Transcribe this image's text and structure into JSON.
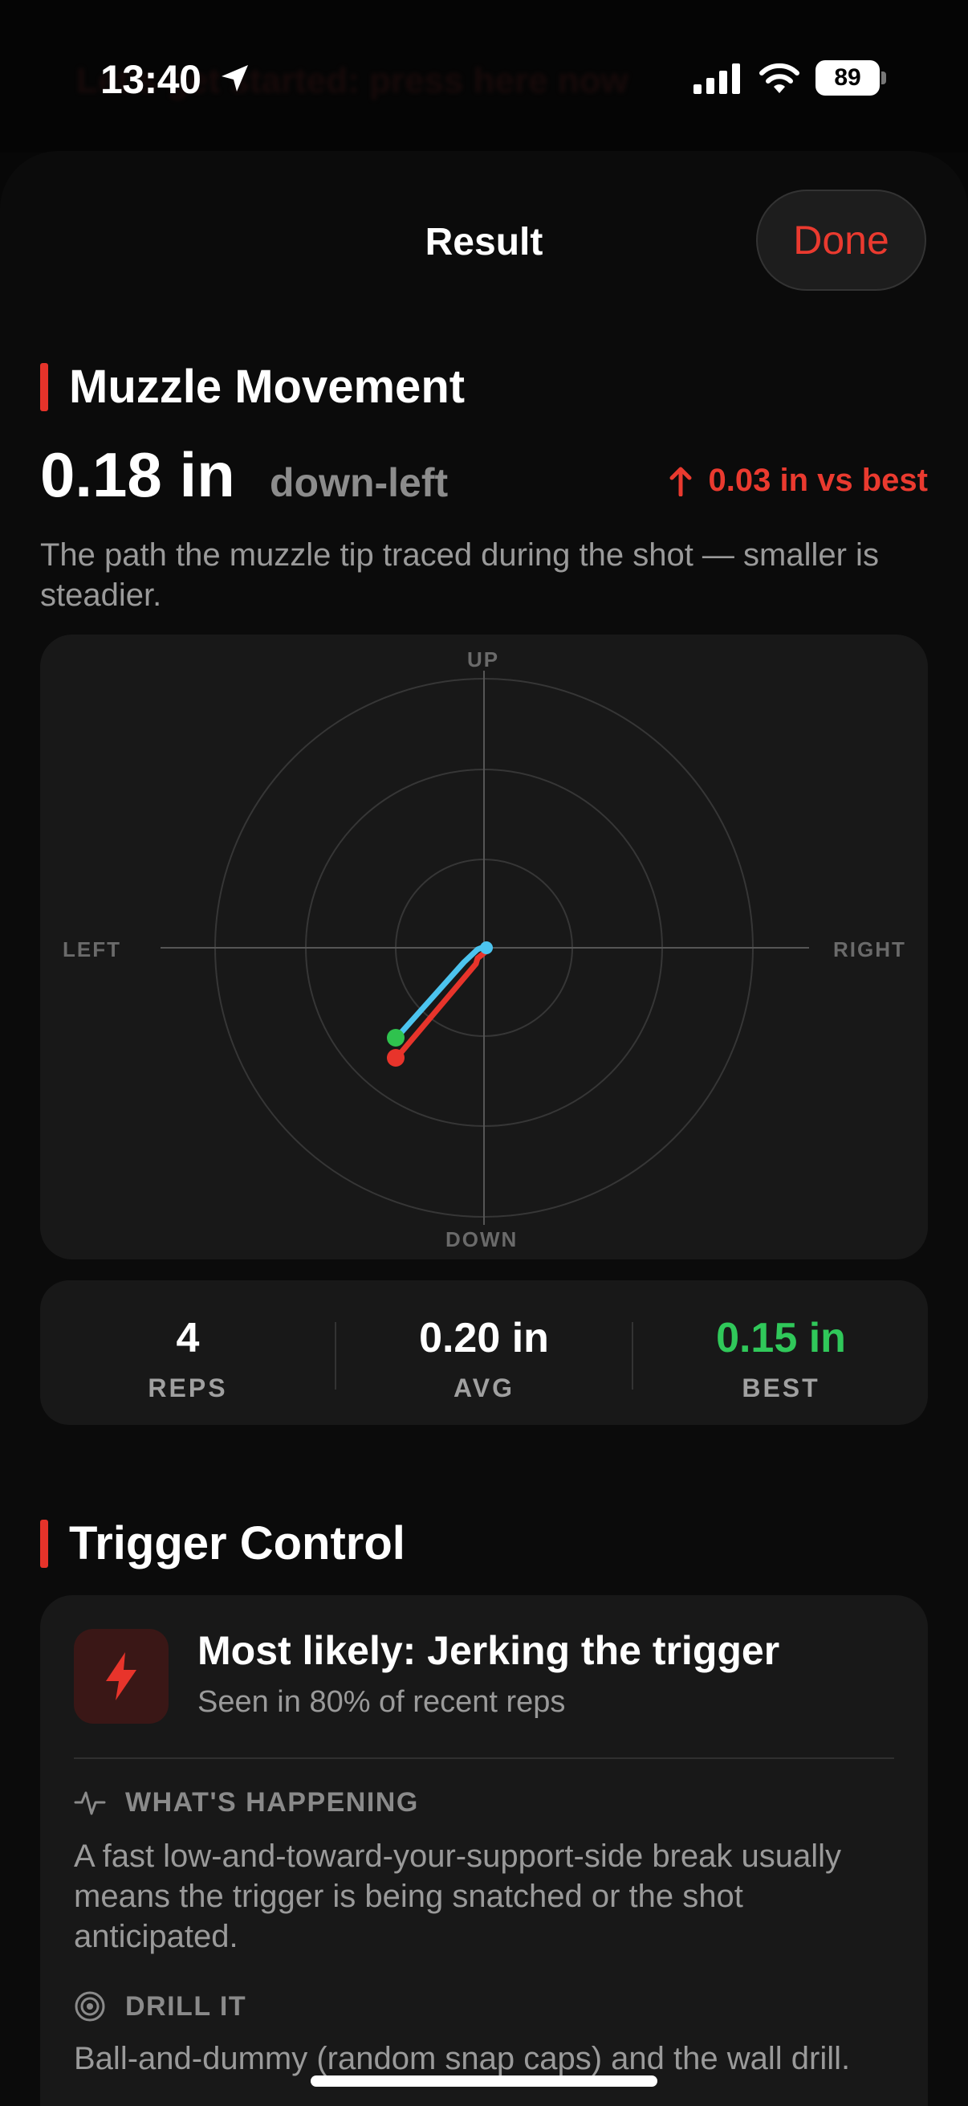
{
  "status_bar": {
    "time": "13:40",
    "battery": "89",
    "obscured_banner": "Let's get started: press here now"
  },
  "header": {
    "title": "Result",
    "done_label": "Done"
  },
  "muzzle": {
    "section_title": "Muzzle Movement",
    "value": "0.18 in",
    "direction": "down-left",
    "delta": "0.03 in vs best",
    "description": "The path the muzzle tip traced during the shot — smaller is steadier.",
    "plot": {
      "axis_labels": {
        "up": "UP",
        "down": "DOWN",
        "left": "LEFT",
        "right": "RIGHT"
      },
      "colors": {
        "current": "#e8342b",
        "best": "#4cc4ef",
        "end_dot_best": "#2fc24e",
        "rings": "#3a3a3a",
        "axes": "#5a5a5a"
      }
    }
  },
  "stats": [
    {
      "value": "4",
      "label": "REPS",
      "color": "#ffffff"
    },
    {
      "value": "0.20 in",
      "label": "AVG",
      "color": "#ffffff"
    },
    {
      "value": "0.15 in",
      "label": "BEST",
      "color": "#30c85a"
    }
  ],
  "trigger": {
    "section_title": "Trigger Control",
    "diagnosis": "Most likely: Jerking the trigger",
    "frequency": "Seen in 80% of recent reps",
    "whats_happening_label": "WHAT'S HAPPENING",
    "whats_happening_text": "A fast low-and-toward-your-support-side break usually means the trigger is being snatched or the shot anticipated.",
    "drill_label": "DRILL IT",
    "drill_text": "Ball-and-dummy (random snap caps) and the wall drill."
  }
}
